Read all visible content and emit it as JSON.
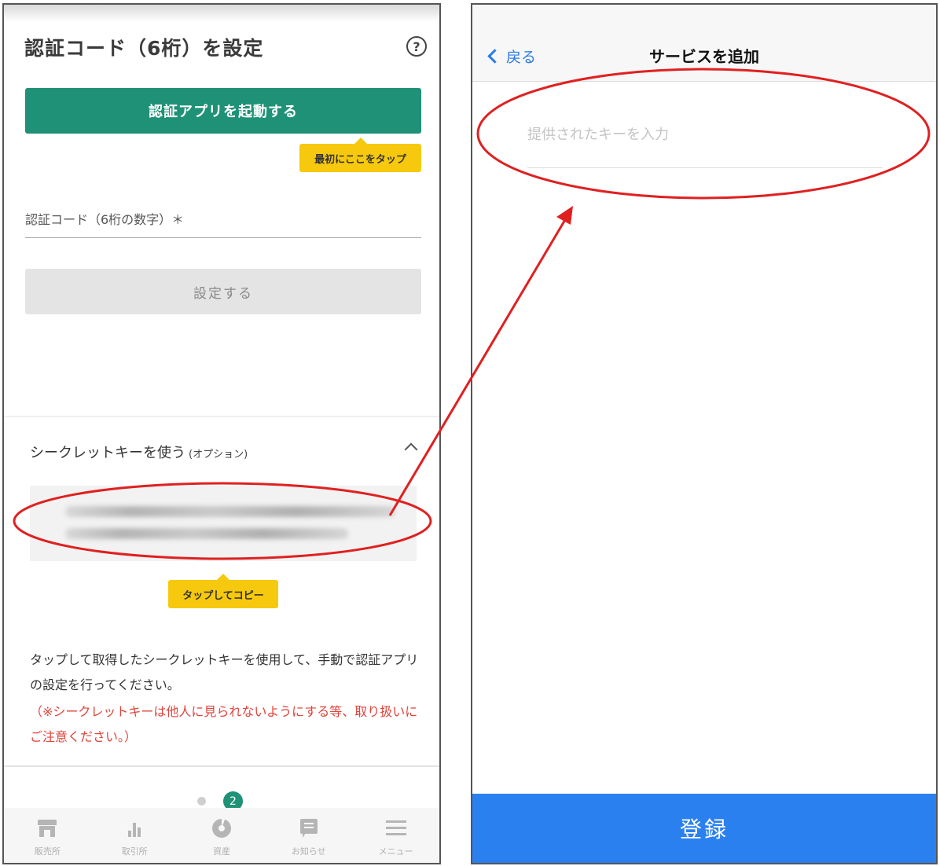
{
  "left_screen": {
    "title": "認証コード（6桁）を設定",
    "help_icon_glyph": "?",
    "launch_button": "認証アプリを起動する",
    "tooltip_first": "最初にここをタップ",
    "code_field_label": "認証コード（6桁の数字）＊",
    "set_button": "設定する",
    "secret_section": {
      "title": "シークレットキーを使う",
      "option_label": "(オプション)"
    },
    "tooltip_copy": "タップしてコピー",
    "instruction": "タップして取得したシークレットキーを使用して、手動で認証アプリの設定を行ってください。",
    "warning": "（※シークレットキーは他人に見られないようにする等、取り扱いにご注意ください。）",
    "pager": {
      "active_page": "2"
    },
    "tabbar": [
      {
        "icon": "shop-icon",
        "label": "販売所"
      },
      {
        "icon": "bar-chart-icon",
        "label": "取引所"
      },
      {
        "icon": "pie-chart-icon",
        "label": "資産"
      },
      {
        "icon": "message-icon",
        "label": "お知らせ"
      },
      {
        "icon": "menu-icon",
        "label": "メニュー"
      }
    ]
  },
  "right_screen": {
    "back_label": "戻る",
    "title": "サービスを追加",
    "key_input_placeholder": "提供されたキーを入力",
    "key_input_value": "",
    "register_button": "登録"
  },
  "colors": {
    "brand_green": "#1f9177",
    "tooltip_yellow": "#f6c90e",
    "warning_red": "#e0443c",
    "ios_blue": "#2b7be9",
    "register_blue": "#2b80f0",
    "annotation_red": "#e02020"
  }
}
